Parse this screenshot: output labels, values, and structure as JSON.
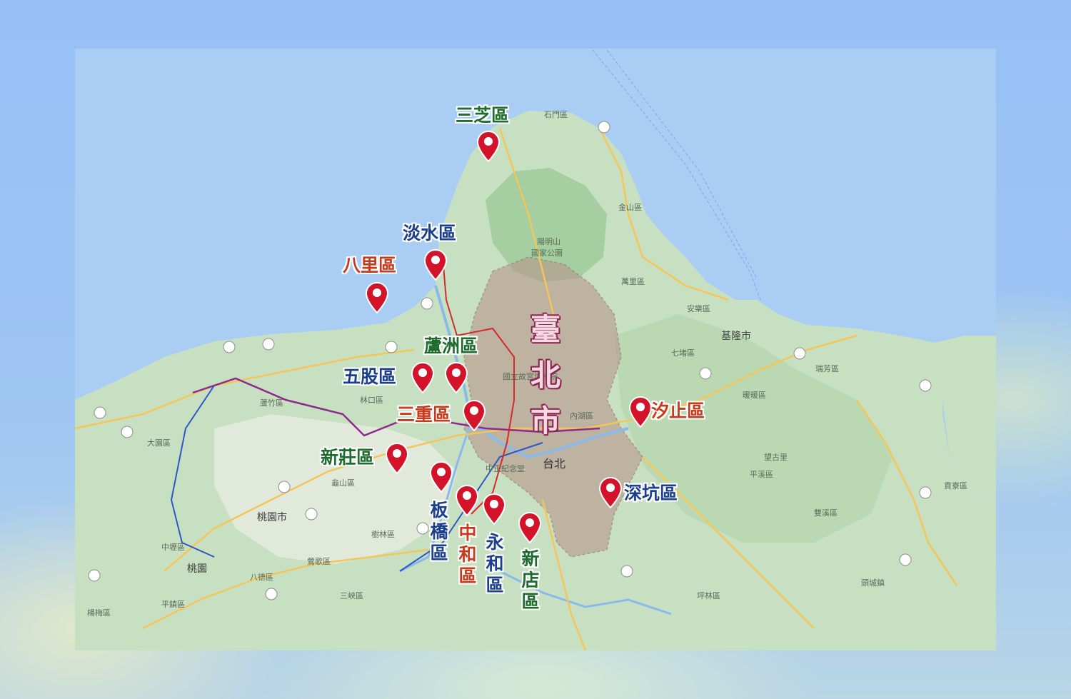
{
  "districts": {
    "sanzhi": "三芝區",
    "tamsui": "淡水區",
    "bali": "八里區",
    "luzhou": "蘆洲區",
    "wugu": "五股區",
    "sanchong": "三重區",
    "xinzhuang": "新莊區",
    "banqiao": "板橋區",
    "zhonghe": "中和區",
    "yonghe": "永和區",
    "xindian": "新店區",
    "xizhi": "汐止區",
    "shenkeng": "深坑區"
  },
  "taipei_label": "臺北市",
  "base_map_labels": {
    "shimen": "石門區",
    "jinshan": "金山區",
    "yangmingshan": "陽明山",
    "national_park": "國家公園",
    "wanli": "萬里區",
    "anle": "安樂區",
    "keelung": "基隆市",
    "qidu": "七堵區",
    "ruifang": "瑞芳區",
    "nuannuan": "暖暖區",
    "pingxi": "平溪區",
    "shuangxi": "雙溪區",
    "gongliao": "貢寮區",
    "toucheng": "頭城鎮",
    "pinglin": "坪林區",
    "taipei": "台北",
    "neihu": "內湖區",
    "chiang_kai_shek": "中正紀念堂",
    "palace_museum": "國立故宮博物院",
    "linkou": "林口區",
    "guishan": "龜山區",
    "taoyuan_city": "桃園市",
    "taoyuan": "桃園",
    "bade": "八德區",
    "dayuan": "大園區",
    "luzhu": "蘆竹區",
    "shulin": "樹林區",
    "yingge": "鶯歌區",
    "sanxia": "三峽區",
    "zhongli": "中壢區",
    "pingzhen": "平鎮區",
    "yangmei": "楊梅區",
    "wangguli": "望古里"
  },
  "colors": {
    "sea": "#a9cdf5",
    "land": "#c9e1c4",
    "mountain": "#9fcc9b",
    "taipei_fill": "#c7a9a0",
    "green_text": "#1e6b2e",
    "blue_text": "#1b3f8c",
    "red_text": "#c73b1d",
    "pin": "#d3132a"
  }
}
